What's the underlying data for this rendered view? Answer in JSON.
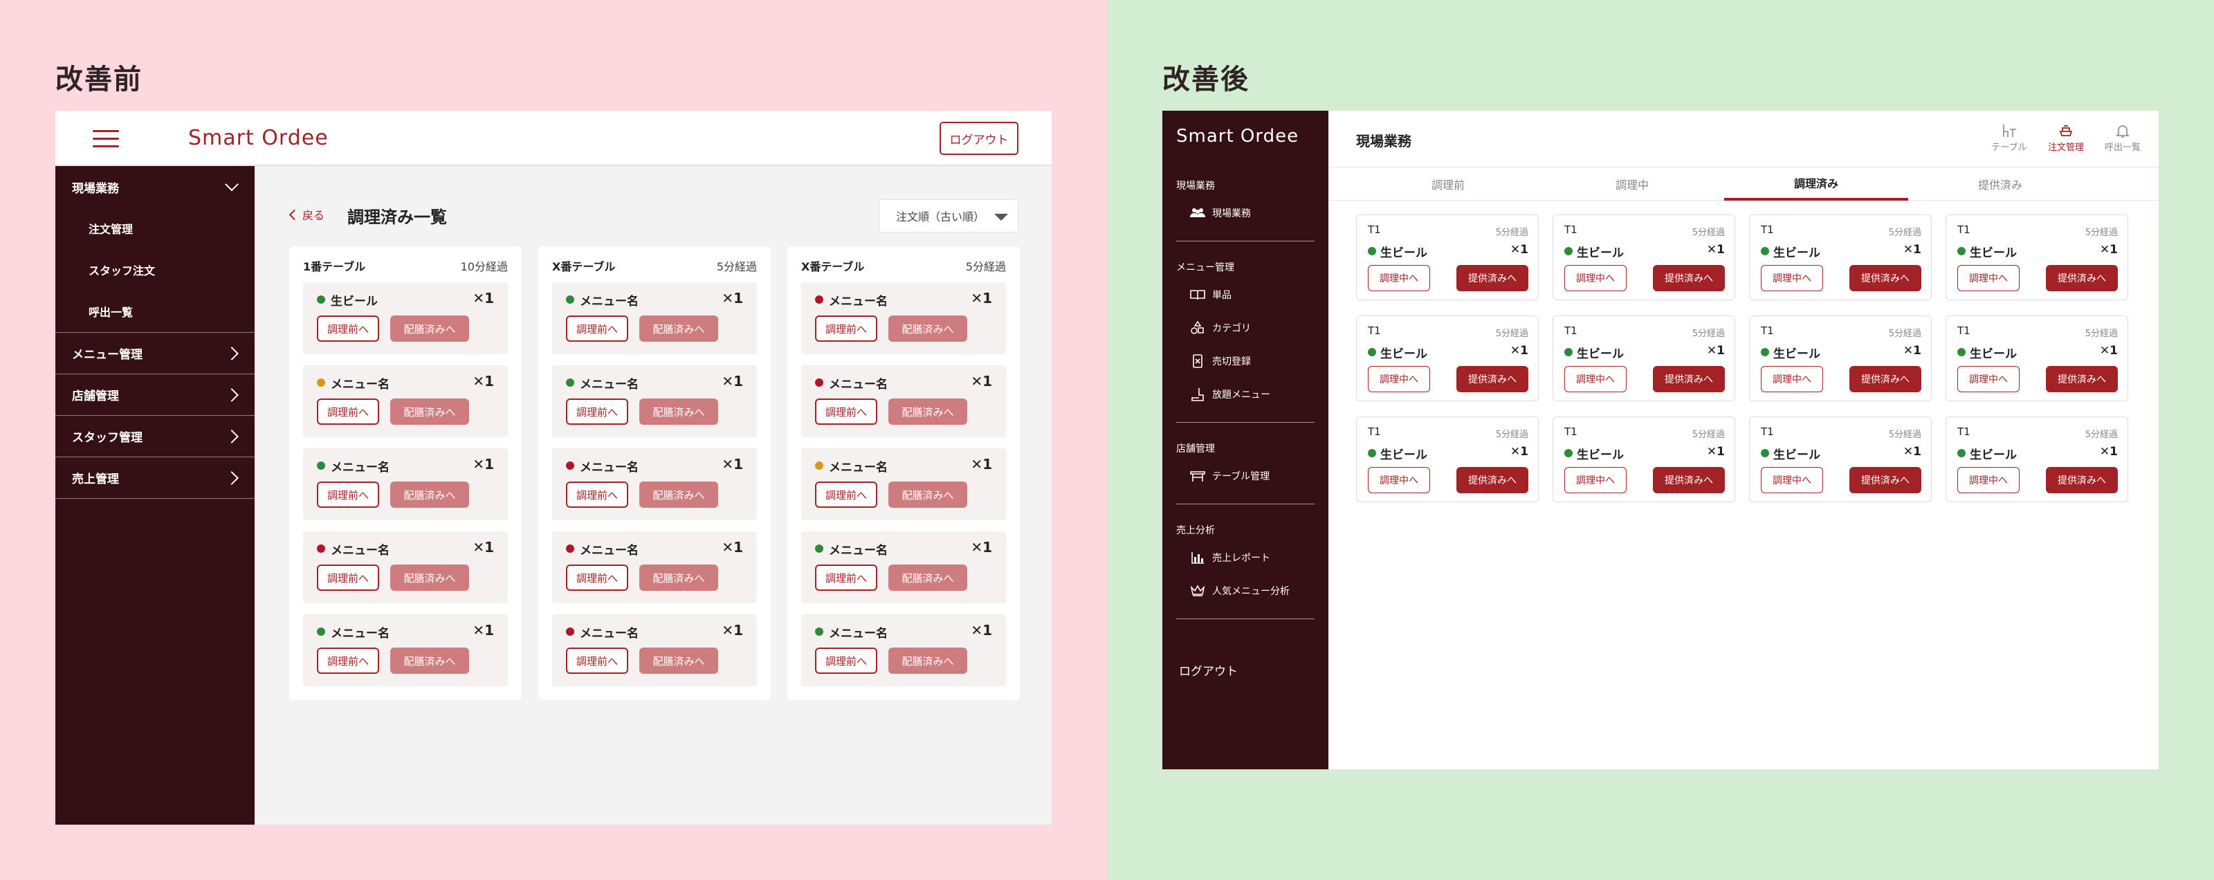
{
  "colors": {
    "brand": "#a32226",
    "sidebar_bg": "#351013",
    "before_bg": "#fdd9df",
    "after_bg": "#d2edd1",
    "dot_green": "#2e8b3c",
    "dot_red": "#b5142a",
    "dot_yellow": "#d59a13",
    "soft_button": "#cf7c7f"
  },
  "before": {
    "section_title": "改善前",
    "header": {
      "brand": "Smart Ordee",
      "logout": "ログアウト"
    },
    "sidebar": {
      "group": "現場業務",
      "sub_items": [
        "注文管理",
        "スタッフ注文",
        "呼出一覧"
      ],
      "items": [
        "メニュー管理",
        "店舗管理",
        "スタッフ管理",
        "売上管理"
      ]
    },
    "back": "戻る",
    "page_title": "調理済み一覧",
    "sort": "注文順（古い順）",
    "btn_prep": "調理前へ",
    "btn_serve": "配膳済みへ",
    "tables": [
      {
        "name": "1番テーブル",
        "elapsed": "10分経過",
        "items": [
          {
            "name": "生ビール",
            "qty": "✕1",
            "status": "green"
          },
          {
            "name": "メニュー名",
            "qty": "✕1",
            "status": "yellow"
          },
          {
            "name": "メニュー名",
            "qty": "✕1",
            "status": "green"
          },
          {
            "name": "メニュー名",
            "qty": "✕1",
            "status": "red"
          },
          {
            "name": "メニュー名",
            "qty": "✕1",
            "status": "green"
          }
        ]
      },
      {
        "name": "X番テーブル",
        "elapsed": "5分経過",
        "items": [
          {
            "name": "メニュー名",
            "qty": "✕1",
            "status": "green"
          },
          {
            "name": "メニュー名",
            "qty": "✕1",
            "status": "green"
          },
          {
            "name": "メニュー名",
            "qty": "✕1",
            "status": "red"
          },
          {
            "name": "メニュー名",
            "qty": "✕1",
            "status": "red"
          },
          {
            "name": "メニュー名",
            "qty": "✕1",
            "status": "red"
          }
        ]
      },
      {
        "name": "X番テーブル",
        "elapsed": "5分経過",
        "items": [
          {
            "name": "メニュー名",
            "qty": "✕1",
            "status": "red"
          },
          {
            "name": "メニュー名",
            "qty": "✕1",
            "status": "red"
          },
          {
            "name": "メニュー名",
            "qty": "✕1",
            "status": "yellow"
          },
          {
            "name": "メニュー名",
            "qty": "✕1",
            "status": "green"
          },
          {
            "name": "メニュー名",
            "qty": "✕1",
            "status": "green"
          }
        ]
      }
    ]
  },
  "after": {
    "section_title": "改善後",
    "brand": "Smart Ordee",
    "sidebar": {
      "groups": [
        {
          "label": "現場業務",
          "items": [
            {
              "label": "現場業務",
              "icon": "people-icon"
            }
          ]
        },
        {
          "label": "メニュー管理",
          "items": [
            {
              "label": "単品",
              "icon": "book-icon"
            },
            {
              "label": "カテゴリ",
              "icon": "shapes-icon"
            },
            {
              "label": "売切登録",
              "icon": "sold-out-icon"
            },
            {
              "label": "放題メニュー",
              "icon": "drink-icon"
            }
          ]
        },
        {
          "label": "店舗管理",
          "items": [
            {
              "label": "テーブル管理",
              "icon": "table-icon"
            }
          ]
        },
        {
          "label": "売上分析",
          "items": [
            {
              "label": "売上レポート",
              "icon": "bar-chart-icon"
            },
            {
              "label": "人気メニュー分析",
              "icon": "crown-icon"
            }
          ]
        }
      ],
      "logout": "ログアウト"
    },
    "page_title": "現場業務",
    "header_icons": [
      {
        "label": "テーブル",
        "icon": "table-chair-icon",
        "active": false
      },
      {
        "label": "注文管理",
        "icon": "order-icon",
        "active": true
      },
      {
        "label": "呼出一覧",
        "icon": "bell-icon",
        "active": false
      }
    ],
    "tabs": [
      {
        "label": "調理前",
        "active": false
      },
      {
        "label": "調理中",
        "active": false
      },
      {
        "label": "調理済み",
        "active": true
      },
      {
        "label": "提供済み",
        "active": false
      }
    ],
    "btn_back": "調理中へ",
    "btn_serve": "提供済みへ",
    "cards": [
      {
        "table": "T1",
        "elapsed": "5分経過",
        "item": "生ビール",
        "qty": "✕1"
      },
      {
        "table": "T1",
        "elapsed": "5分経過",
        "item": "生ビール",
        "qty": "✕1"
      },
      {
        "table": "T1",
        "elapsed": "5分経過",
        "item": "生ビール",
        "qty": "✕1"
      },
      {
        "table": "T1",
        "elapsed": "5分経過",
        "item": "生ビール",
        "qty": "✕1"
      },
      {
        "table": "T1",
        "elapsed": "5分経過",
        "item": "生ビール",
        "qty": "✕1"
      },
      {
        "table": "T1",
        "elapsed": "5分経過",
        "item": "生ビール",
        "qty": "✕1"
      },
      {
        "table": "T1",
        "elapsed": "5分経過",
        "item": "生ビール",
        "qty": "✕1"
      },
      {
        "table": "T1",
        "elapsed": "5分経過",
        "item": "生ビール",
        "qty": "✕1"
      },
      {
        "table": "T1",
        "elapsed": "5分経過",
        "item": "生ビール",
        "qty": "✕1"
      },
      {
        "table": "T1",
        "elapsed": "5分経過",
        "item": "生ビール",
        "qty": "✕1"
      },
      {
        "table": "T1",
        "elapsed": "5分経過",
        "item": "生ビール",
        "qty": "✕1"
      },
      {
        "table": "T1",
        "elapsed": "5分経過",
        "item": "生ビール",
        "qty": "✕1"
      }
    ]
  }
}
